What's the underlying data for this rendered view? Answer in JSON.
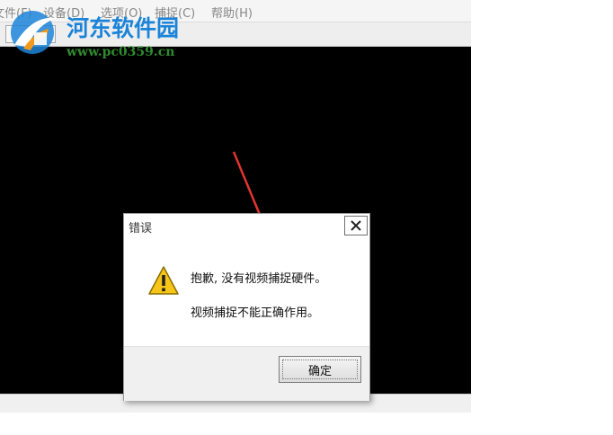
{
  "menu": {
    "file": "文件(F)",
    "device": "设备(D)",
    "options": "选项(O)",
    "capture": "捕捉(C)",
    "help": "帮助(H)"
  },
  "watermark": {
    "title": "河东软件园",
    "url": "www.pc0359.cn"
  },
  "dialog": {
    "title": "错误",
    "line1": "抱歉, 没有视频捕捉硬件。",
    "line2": "视频捕捉不能正确作用。",
    "ok_label": "确定"
  },
  "colors": {
    "video_bg": "#000000",
    "arrow": "#e3342f",
    "watermark_blue": "#1b84d8",
    "watermark_green": "#2f8a2f"
  }
}
